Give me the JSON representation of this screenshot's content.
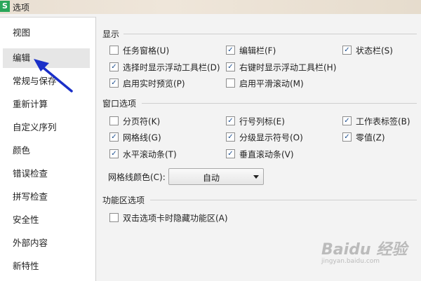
{
  "window": {
    "title": "选项",
    "app_icon": "S"
  },
  "sidebar": {
    "items": [
      {
        "label": "视图",
        "active": false
      },
      {
        "label": "编辑",
        "active": true
      },
      {
        "label": "常规与保存",
        "active": false
      },
      {
        "label": "重新计算",
        "active": false
      },
      {
        "label": "自定义序列",
        "active": false
      },
      {
        "label": "颜色",
        "active": false
      },
      {
        "label": "错误检查",
        "active": false
      },
      {
        "label": "拼写检查",
        "active": false
      },
      {
        "label": "安全性",
        "active": false
      },
      {
        "label": "外部内容",
        "active": false
      },
      {
        "label": "新特性",
        "active": false
      }
    ]
  },
  "display": {
    "title": "显示",
    "options": [
      {
        "label": "任务窗格(U)",
        "checked": false
      },
      {
        "label": "编辑栏(F)",
        "checked": true
      },
      {
        "label": "状态栏(S)",
        "checked": true
      },
      {
        "label": "选择时显示浮动工具栏(D)",
        "checked": true
      },
      {
        "label": "右键时显示浮动工具栏(H)",
        "checked": true
      },
      {
        "label": "启用实时预览(P)",
        "checked": true
      },
      {
        "label": "启用平滑滚动(M)",
        "checked": false
      }
    ]
  },
  "window_options": {
    "title": "窗口选项",
    "options": [
      {
        "label": "分页符(K)",
        "checked": false
      },
      {
        "label": "行号列标(E)",
        "checked": true
      },
      {
        "label": "工作表标签(B)",
        "checked": true
      },
      {
        "label": "网格线(G)",
        "checked": true
      },
      {
        "label": "分级显示符号(O)",
        "checked": true
      },
      {
        "label": "零值(Z)",
        "checked": true
      },
      {
        "label": "水平滚动条(T)",
        "checked": true
      },
      {
        "label": "垂直滚动条(V)",
        "checked": true
      }
    ],
    "gridline_color_label": "网格线颜色(C):",
    "gridline_color_value": "自动"
  },
  "ribbon": {
    "title": "功能区选项",
    "options": [
      {
        "label": "双击选项卡时隐藏功能区(A)",
        "checked": false
      }
    ]
  },
  "watermark": {
    "main": "Baidu 经验",
    "sub": "jingyan.baidu.com"
  },
  "colors": {
    "checkmark": "#1d4f8f",
    "annotation_arrow": "#1a2fc8",
    "accent": "#2aa65a"
  }
}
